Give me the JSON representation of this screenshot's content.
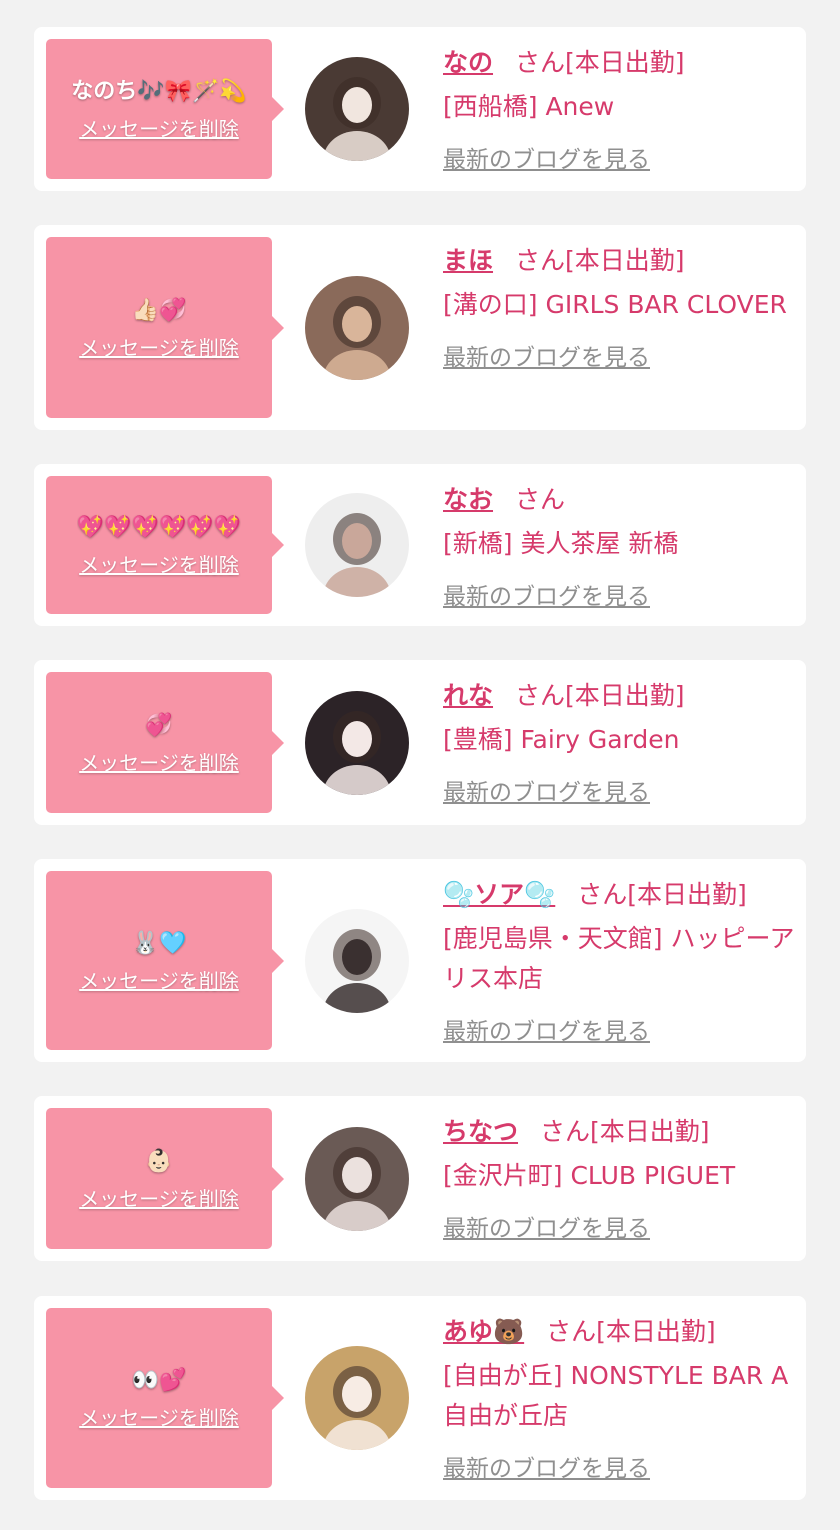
{
  "delete_label": "メッセージを削除",
  "san_label": "さん",
  "working_label": "[本日出勤]",
  "blog_label": "最新のブログを見る",
  "cards": [
    {
      "message": "なのち🎶🎀🪄💫",
      "name": "なの",
      "working": true,
      "shop": "[西船橋] Anew",
      "avatar_color": "#4a3a34",
      "avatar_accent": "#f1e6df"
    },
    {
      "message": "👍🏻💞",
      "name": "まほ",
      "working": true,
      "shop": "[溝の口] GIRLS BAR CLOVER",
      "avatar_color": "#8a6a5a",
      "avatar_accent": "#d9b59a"
    },
    {
      "message": "💖💖💖💖💖💖",
      "name": "なお",
      "working": false,
      "shop": "[新橋] 美人茶屋 新橋",
      "avatar_color": "#eeeeee",
      "avatar_accent": "#c9a79a"
    },
    {
      "message": "💞",
      "name": "れな",
      "working": true,
      "shop": "[豊橋] Fairy Garden",
      "avatar_color": "#2c2327",
      "avatar_accent": "#f3e8e6"
    },
    {
      "message": "🐰🩵",
      "name": "🫧ソア🫧",
      "working": true,
      "shop": "[鹿児島県・天文館] ハッピーアリス本店",
      "avatar_color": "#f5f5f5",
      "avatar_accent": "#3a3030"
    },
    {
      "message": "👶🏻",
      "name": "ちなつ",
      "working": true,
      "shop": "[金沢片町] CLUB PIGUET",
      "avatar_color": "#6a5a55",
      "avatar_accent": "#ebe1de"
    },
    {
      "message": "👀💕",
      "name": "あゆ🐻",
      "working": true,
      "shop": "[自由が丘] NONSTYLE BAR A 自由が丘店",
      "avatar_color": "#c8a36a",
      "avatar_accent": "#f7ece4"
    }
  ]
}
